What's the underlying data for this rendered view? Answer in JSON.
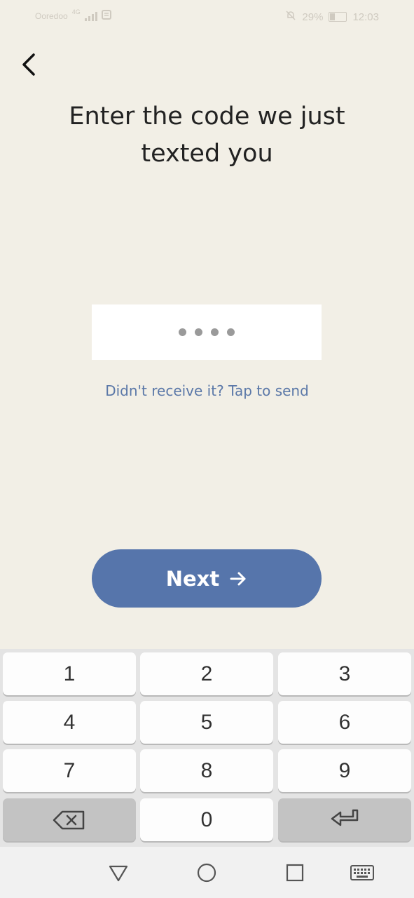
{
  "status_bar": {
    "carrier": "Ooredoo",
    "network_type": "4G",
    "battery": "29%",
    "battery_level": 0.29,
    "time": "12:03"
  },
  "header": {
    "back_icon": "chevron-left-icon",
    "title_line1": "Enter the code we just",
    "title_line2": "texted you"
  },
  "code_input": {
    "digits_entered": 4,
    "mask_char": "•"
  },
  "resend_link": "Didn't receive it? Tap to send",
  "next_button": {
    "label": "Next",
    "arrow": "→",
    "color": "#5675ab"
  },
  "keyboard": {
    "keys": [
      "1",
      "2",
      "3",
      "4",
      "5",
      "6",
      "7",
      "8",
      "9",
      "backspace-icon",
      "0",
      "enter-icon"
    ]
  },
  "nav_bar": {
    "buttons": [
      "back-triangle-icon",
      "home-circle-icon",
      "recents-square-icon",
      "keyboard-icon"
    ]
  },
  "colors": {
    "background": "#f2efe6",
    "link": "#5b78a8",
    "accent": "#5675ab"
  }
}
